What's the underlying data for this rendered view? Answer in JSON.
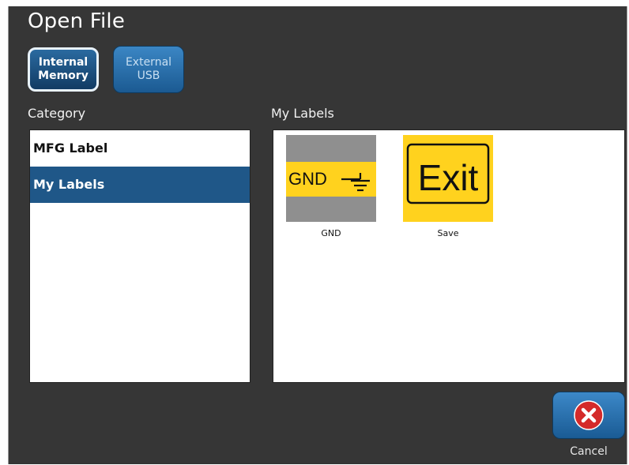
{
  "window": {
    "title": "Open File"
  },
  "source_buttons": {
    "internal": "Internal\nMemory",
    "external": "External\nUSB"
  },
  "category": {
    "heading": "Category",
    "items": [
      {
        "label": "MFG Label"
      },
      {
        "label": "My Labels"
      }
    ],
    "selected_index": 1
  },
  "labels": {
    "heading": "My Labels",
    "items": [
      {
        "caption": "GND",
        "thumb_text": "GND"
      },
      {
        "caption": "Save",
        "thumb_text": "Exit"
      }
    ]
  },
  "footer": {
    "cancel_label": "Cancel"
  },
  "colors": {
    "background": "#363636",
    "accent_blue": "#1f5788",
    "label_yellow": "#ffd21e",
    "label_gray": "#8f8f8f",
    "cancel_red": "#d42a2a"
  },
  "icons": {
    "cancel": "close-x-circle-icon",
    "ground": "ground-symbol-icon"
  }
}
